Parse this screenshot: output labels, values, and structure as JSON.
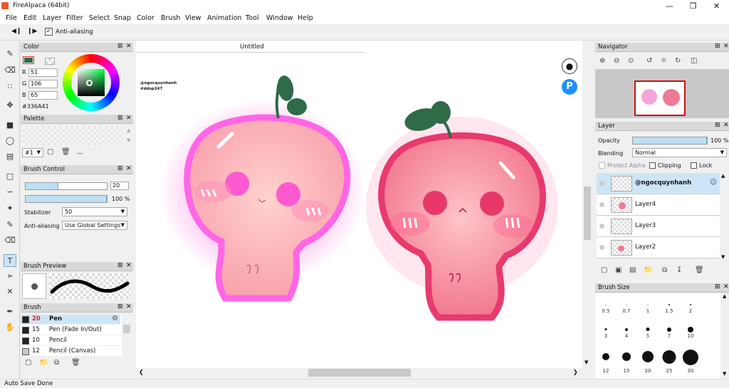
{
  "window": {
    "title": "FireAlpaca (64bit)"
  },
  "menu": [
    "File",
    "Edit",
    "Layer",
    "Filter",
    "Select",
    "Snap",
    "Color",
    "Brush",
    "View",
    "Animation",
    "Tool",
    "Window",
    "Help"
  ],
  "toolbar": {
    "antialias_label": "Anti-aliasing",
    "antialias_checked": true
  },
  "color_panel": {
    "title": "Color",
    "r_label": "R",
    "g_label": "G",
    "b_label": "B",
    "r": "51",
    "g": "106",
    "b": "65",
    "hex": "#336A41",
    "current_color": "#336A41"
  },
  "palette_panel": {
    "title": "Palette",
    "index": "#1",
    "sep": "---"
  },
  "brush_control": {
    "title": "Brush Control",
    "size": "20",
    "size_fraction": 0.4,
    "opacity": "100 %",
    "opacity_fraction": 1.0,
    "stabilizer_label": "Stabilizer",
    "stabilizer_value": "50",
    "antialias_label": "Anti-aliasing",
    "antialias_value": "Use Global Settings"
  },
  "brush_preview": {
    "title": "Brush Preview"
  },
  "brush_panel": {
    "title": "Brush",
    "items": [
      {
        "size": "20",
        "name": "Pen",
        "selected": true
      },
      {
        "size": "15",
        "name": "Pen (Fade In/Out)"
      },
      {
        "size": "10",
        "name": "Pencil"
      },
      {
        "size": "12",
        "name": "Pencil (Canvas)"
      }
    ]
  },
  "canvas": {
    "tab": "Untitled",
    "watermark_line1": "@ngocquynhanh",
    "watermark_line2": "#ddsp247",
    "badge_p": "P"
  },
  "navigator": {
    "title": "Navigator"
  },
  "layer_panel": {
    "title": "Layer",
    "opacity_label": "Opacity",
    "opacity_value": "100 %",
    "opacity_fraction": 1.0,
    "blending_label": "Blending",
    "blending_value": "Normal",
    "protect_alpha": "Protect Alpha",
    "clipping": "Clipping",
    "lock": "Lock",
    "layers": [
      {
        "name": "@ngocquynhanh",
        "selected": true
      },
      {
        "name": "Layer4"
      },
      {
        "name": "Layer3"
      },
      {
        "name": "Layer2"
      }
    ]
  },
  "brush_size_panel": {
    "title": "Brush Size",
    "sizes": [
      "0.5",
      "0.7",
      "1",
      "1.5",
      "2",
      "3",
      "4",
      "5",
      "7",
      "10",
      "12",
      "15",
      "20",
      "25",
      "30"
    ]
  },
  "status": {
    "text": "Auto Save Done"
  }
}
